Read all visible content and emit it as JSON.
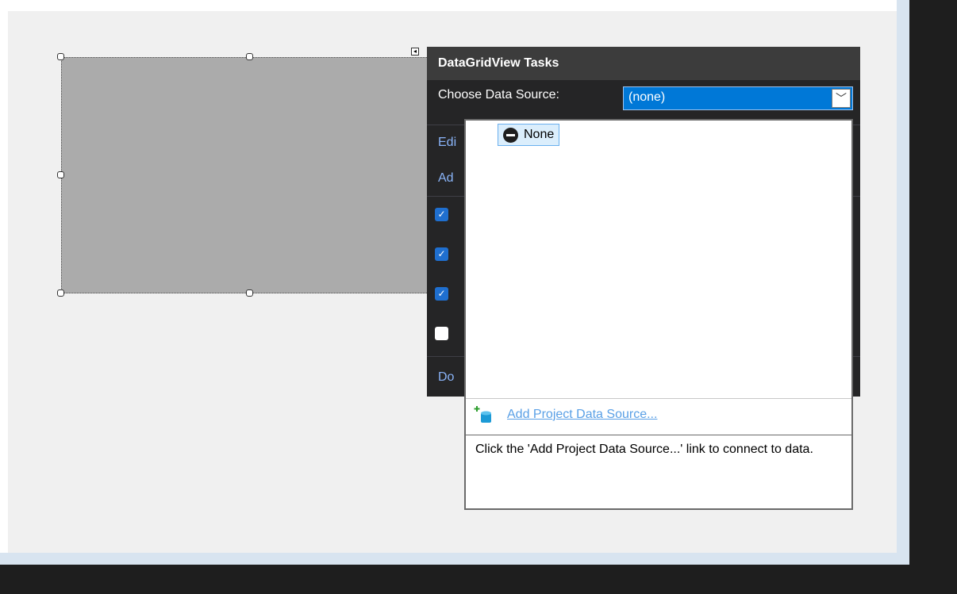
{
  "panel": {
    "title": "DataGridView Tasks",
    "choose_label": "Choose Data Source:",
    "combo_value": "(none)",
    "partial_links": [
      "Edi",
      "Ad"
    ],
    "dock_partial": "Do",
    "checkboxes": [
      true,
      true,
      true,
      false
    ]
  },
  "dropdown": {
    "none_label": "None",
    "add_link": "Add Project Data Source...",
    "hint": "Click the 'Add Project Data Source...' link to connect to data."
  },
  "icons": {
    "smart_tag": "smart-tag-arrow-icon",
    "combo_arrow": "chevron-down-icon",
    "none": "no-entry-icon",
    "add_source": "add-database-icon"
  },
  "colors": {
    "panel_bg": "#252526",
    "header_bg": "#3c3c3c",
    "combo_selected": "#0078d7",
    "link": "#5aa0e6"
  }
}
